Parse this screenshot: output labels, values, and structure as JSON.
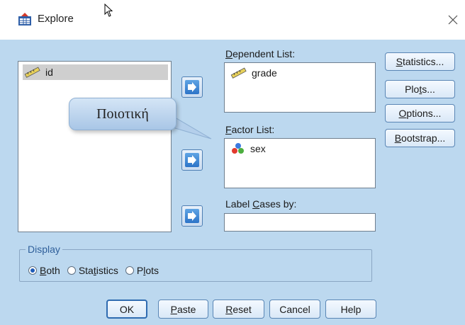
{
  "window": {
    "title": "Explore"
  },
  "variables": [
    {
      "name": "id"
    }
  ],
  "dependent_list": {
    "label_before": "",
    "label_mnemonic": "D",
    "label_after": "ependent List:",
    "items": [
      {
        "name": "grade"
      }
    ]
  },
  "factor_list": {
    "label_before": "",
    "label_mnemonic": "F",
    "label_after": "actor List:",
    "items": [
      {
        "name": "sex"
      }
    ]
  },
  "label_cases": {
    "label_before": "Label ",
    "label_mnemonic": "C",
    "label_after": "ases by:",
    "value": ""
  },
  "side_buttons": {
    "statistics": {
      "before": "",
      "mn": "S",
      "after": "tatistics..."
    },
    "plots": {
      "before": "Plo",
      "mn": "t",
      "after": "s..."
    },
    "options": {
      "before": "",
      "mn": "O",
      "after": "ptions..."
    },
    "bootstrap": {
      "before": "",
      "mn": "B",
      "after": "ootstrap..."
    }
  },
  "display": {
    "legend": "Display",
    "options": {
      "both": {
        "before": "",
        "mn": "B",
        "after": "oth",
        "selected": true
      },
      "statistics": {
        "before": "Sta",
        "mn": "t",
        "after": "istics",
        "selected": false
      },
      "plots": {
        "before": "P",
        "mn": "l",
        "after": "ots",
        "selected": false
      }
    }
  },
  "bottom_buttons": {
    "ok": {
      "before": "OK",
      "mn": "",
      "after": ""
    },
    "paste": {
      "before": "",
      "mn": "P",
      "after": "aste"
    },
    "reset": {
      "before": "",
      "mn": "R",
      "after": "eset"
    },
    "cancel": {
      "before": "Cancel",
      "mn": "",
      "after": ""
    },
    "help": {
      "before": "Help",
      "mn": "",
      "after": ""
    }
  },
  "annotation": {
    "text": "Ποιοτική"
  },
  "colors": {
    "dialog_bg": "#bcd8ef",
    "arrow_button": "#2d74c8",
    "selected_row": "#cfcfcf"
  }
}
